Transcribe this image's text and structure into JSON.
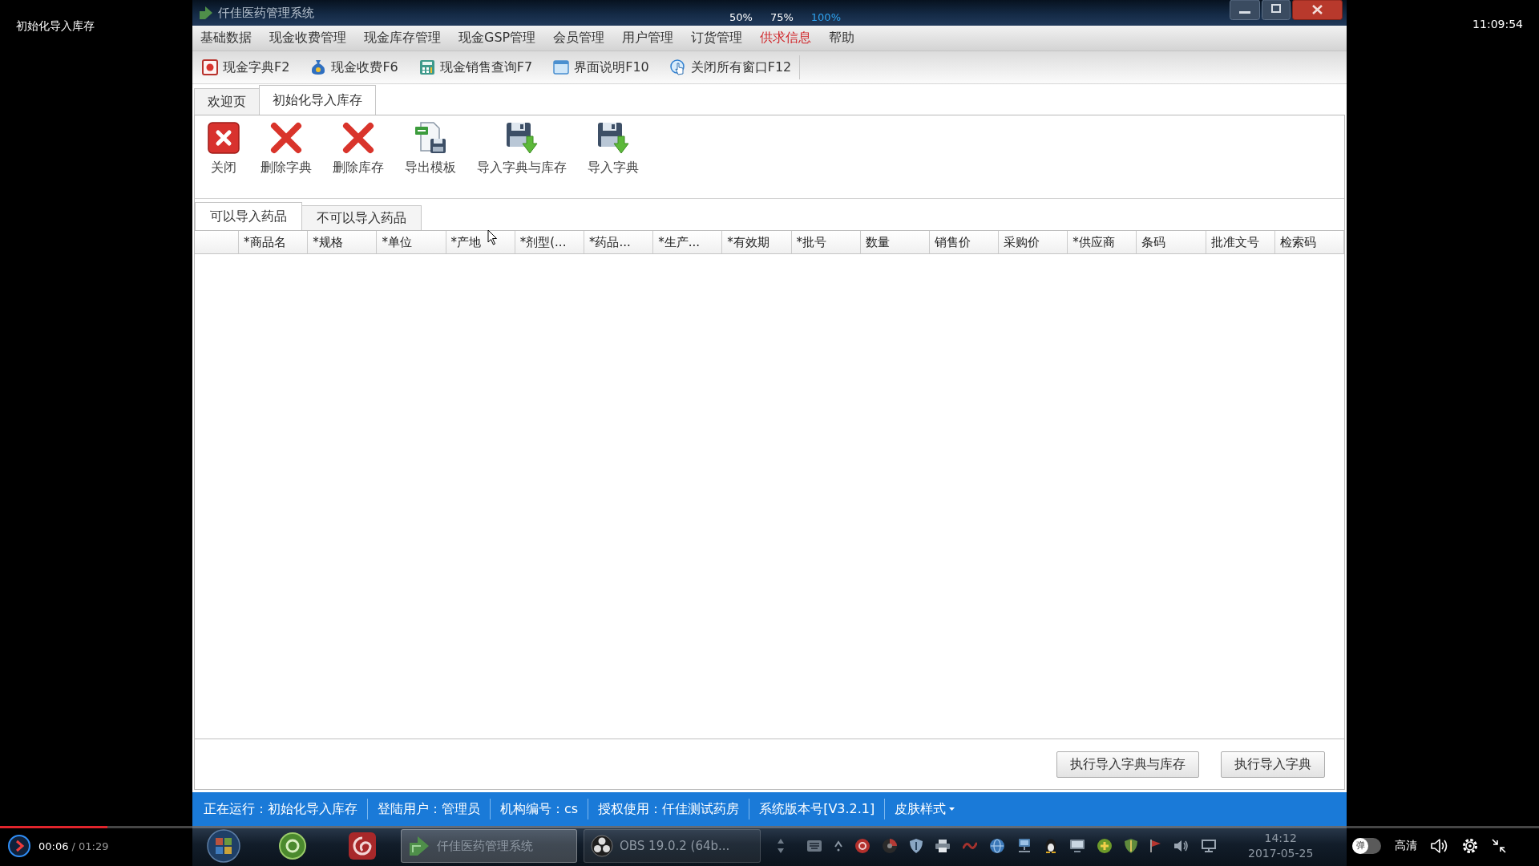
{
  "player": {
    "title": "初始化导入库存",
    "clock": "11:09:54",
    "scale_options": [
      {
        "label": "50%",
        "selected": false
      },
      {
        "label": "75%",
        "selected": false
      },
      {
        "label": "100%",
        "selected": true
      }
    ],
    "progress": {
      "level": 0.07
    },
    "elapsed": "00:06",
    "duration": "/ 01:29",
    "danmaku": {
      "label": "弹",
      "on": false
    },
    "quality": "高清"
  },
  "window": {
    "title": "仟佳医药管理系统",
    "menu": [
      {
        "label": "基础数据",
        "highlighted": false
      },
      {
        "label": "现金收费管理",
        "highlighted": false
      },
      {
        "label": "现金库存管理",
        "highlighted": false
      },
      {
        "label": "现金GSP管理",
        "highlighted": false
      },
      {
        "label": "会员管理",
        "highlighted": false
      },
      {
        "label": "用户管理",
        "highlighted": false
      },
      {
        "label": "订货管理",
        "highlighted": false
      },
      {
        "label": "供求信息",
        "highlighted": true
      },
      {
        "label": "帮助",
        "highlighted": false
      }
    ],
    "quick_tools": [
      {
        "label": "现金字典F2",
        "kind": "dictionary"
      },
      {
        "label": "现金收费F6",
        "kind": "cashier"
      },
      {
        "label": "现金销售查询F7",
        "kind": "query"
      },
      {
        "label": "界面说明F10",
        "kind": "manual"
      },
      {
        "label": "关闭所有窗口F12",
        "kind": "closeall"
      }
    ],
    "tabs": [
      {
        "label": "欢迎页",
        "selected": false
      },
      {
        "label": "初始化导入库存",
        "selected": true
      }
    ],
    "ribbon": [
      {
        "label": "关闭",
        "kind": "close"
      },
      {
        "label": "删除字典",
        "kind": "delete"
      },
      {
        "label": "删除库存",
        "kind": "delete"
      },
      {
        "label": "导出模板",
        "kind": "export"
      },
      {
        "label": "导入字典与库存",
        "kind": "import"
      },
      {
        "label": "导入字典",
        "kind": "import"
      }
    ],
    "sub_tabs": [
      {
        "label": "可以导入药品",
        "selected": true
      },
      {
        "label": "不可以导入药品",
        "selected": false
      }
    ],
    "table": {
      "columns": [
        "*商品名",
        "*规格",
        "*单位",
        "*产地",
        "*剂型(...",
        "*药品...",
        "*生产...",
        "*有效期",
        "*批号",
        "数量",
        "销售价",
        "采购价",
        "*供应商",
        "条码",
        "批准文号",
        "检索码"
      ]
    },
    "actions": [
      "执行导入字典与库存",
      "执行导入字典"
    ],
    "status_bar": {
      "items": [
        "正在运行：初始化导入库存",
        "登陆用户：管理员",
        "机构编号：cs",
        "授权使用：仟佳测试药房",
        "系统版本号[V3.2.1]"
      ],
      "skin_menu": "皮肤样式"
    }
  },
  "taskbar": {
    "tasks": [
      {
        "label": "仟佳医药管理系统",
        "selected": true,
        "kind": "pharmacy"
      },
      {
        "label": "OBS 19.0.2 (64b...",
        "selected": false,
        "kind": "obs"
      }
    ],
    "clock": {
      "time": "14:12",
      "date": "2017-05-25"
    }
  }
}
